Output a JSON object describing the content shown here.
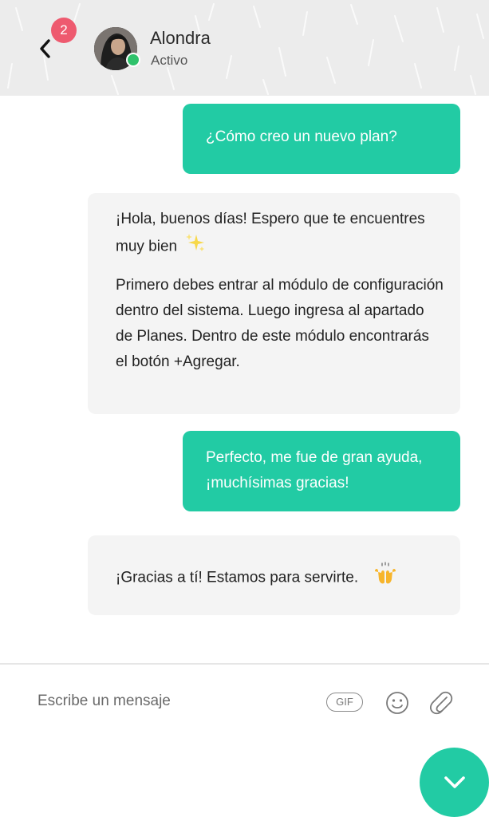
{
  "header": {
    "unread_count": "2",
    "contact_name": "Alondra",
    "contact_status": "Activo",
    "status_color": "#2fc26b",
    "badge_color": "#ee5a6f"
  },
  "messages": [
    {
      "direction": "outgoing",
      "paragraphs": [
        "¿Cómo creo un nuevo plan?"
      ]
    },
    {
      "direction": "incoming",
      "paragraphs": [
        "¡Hola, buenos días! Espero que te encuentres muy bien",
        "Primero debes entrar al módulo de configuración dentro del sistema. Luego ingresa al apartado de Planes.  Dentro de este módulo encontrarás el botón +Agregar."
      ],
      "emoji": "sparkles-emoji"
    },
    {
      "direction": "outgoing",
      "paragraphs": [
        "Perfecto, me fue de gran ayuda, ¡muchísimas gracias!"
      ]
    },
    {
      "direction": "incoming",
      "paragraphs": [
        "¡Gracias a tí! Estamos para servirte."
      ],
      "emoji": "raising-hands-emoji"
    }
  ],
  "composer": {
    "placeholder": "Escribe un mensaje",
    "gif_label": "GIF",
    "icons": [
      "gif-icon",
      "smiley-icon",
      "paperclip-icon"
    ]
  },
  "fab": {
    "icon": "chevron-down-icon"
  },
  "colors": {
    "outgoing_bubble": "#22cba4",
    "incoming_bubble": "#f4f4f4",
    "accent": "#22cba4"
  }
}
